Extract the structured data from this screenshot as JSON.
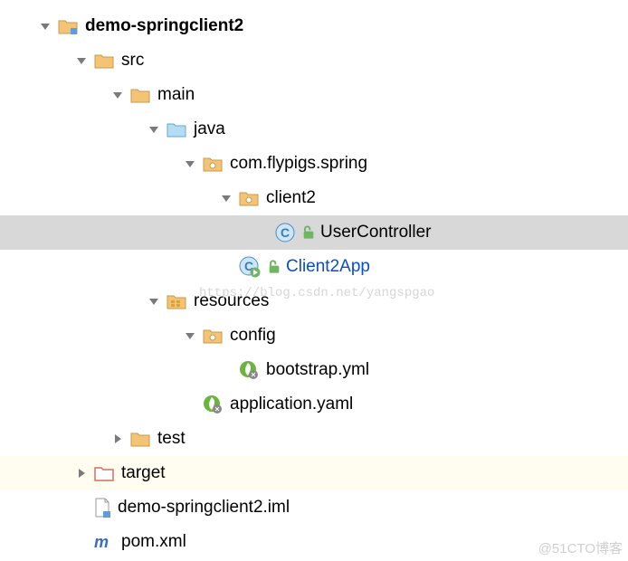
{
  "tree": {
    "project": "demo-springclient2",
    "src": "src",
    "main": "main",
    "java": "java",
    "package": "com.flypigs.spring",
    "client2": "client2",
    "userController": "UserController",
    "client2App": "Client2App",
    "resources": "resources",
    "config": "config",
    "bootstrap": "bootstrap.yml",
    "application": "application.yaml",
    "test": "test",
    "target": "target",
    "iml": "demo-springclient2.iml",
    "pom": "pom.xml"
  },
  "watermarks": {
    "csdn": "https://blog.csdn.net/yangspgao",
    "cto": "@51CTO博客"
  }
}
